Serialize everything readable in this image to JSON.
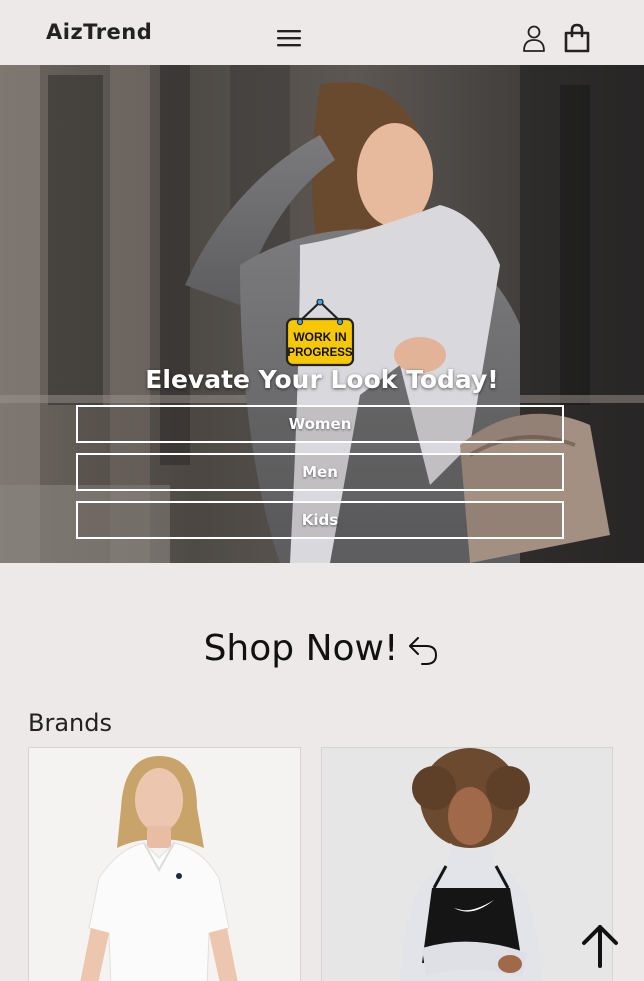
{
  "header": {
    "logo": "AizTrend",
    "menu_icon": "hamburger-menu-icon",
    "user_icon": "user-icon",
    "cart_icon": "shopping-bag-icon"
  },
  "hero": {
    "badge_line1": "WORK IN",
    "badge_line2": "PROGRESS",
    "title": "Elevate Your Look Today!",
    "categories": [
      "Women",
      "Men",
      "Kids"
    ]
  },
  "shop": {
    "title": "Shop Now!",
    "arrow_icon": "return-arrow-icon"
  },
  "brands": {
    "title": "Brands"
  },
  "back_to_top_icon": "arrow-up-icon",
  "colors": {
    "background": "#ece9e8",
    "badge_yellow": "#f7c800"
  }
}
